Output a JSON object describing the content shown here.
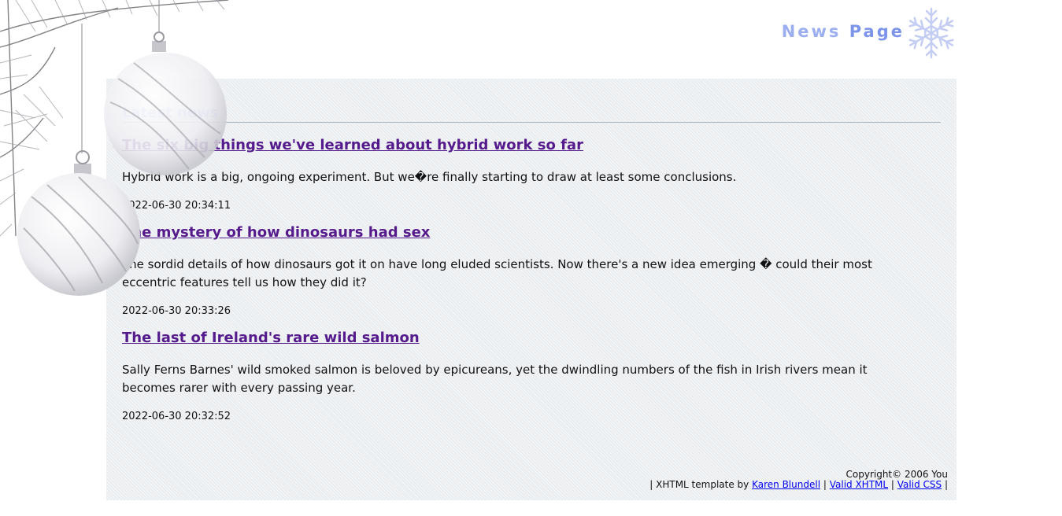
{
  "header": {
    "title_word1": "News",
    "title_word2": "Page",
    "snowflake_icon": "snowflake-icon"
  },
  "main": {
    "section_heading": "Latest news",
    "articles": [
      {
        "title": "The six big things we've learned about hybrid work so far",
        "summary": "Hybrid work is a big, ongoing experiment. But we�re finally starting to draw at least some conclusions.",
        "date": "2022-06-30 20:34:11"
      },
      {
        "title": "The mystery of how dinosaurs had sex",
        "summary": "The sordid details of how dinosaurs got it on have long eluded scientists. Now there's a new idea emerging � could their most eccentric features tell us how they did it?",
        "date": "2022-06-30 20:33:26"
      },
      {
        "title": "The last of Ireland's rare wild salmon",
        "summary": "Sally Ferns Barnes' wild smoked salmon is beloved by epicureans, yet the dwindling numbers of the fish in Irish rivers mean it becomes rarer with every passing year.",
        "date": "2022-06-30 20:32:52"
      }
    ]
  },
  "footer": {
    "copyright": "Copyright© 2006 You",
    "sep_start": "| XHTML template by",
    "author_link": "Karen Blundell",
    "sep1": "|",
    "valid_xhtml": "Valid XHTML",
    "sep2": "|",
    "valid_css": "Valid CSS",
    "sep_end": "|"
  },
  "colors": {
    "accent_title": "#9aaef0",
    "link_visited": "#551a8b",
    "link": "#0000ee",
    "panel_bg": "#e9edf0"
  },
  "decorations": [
    "christmas-ornaments-image",
    "snowflake-icon"
  ]
}
